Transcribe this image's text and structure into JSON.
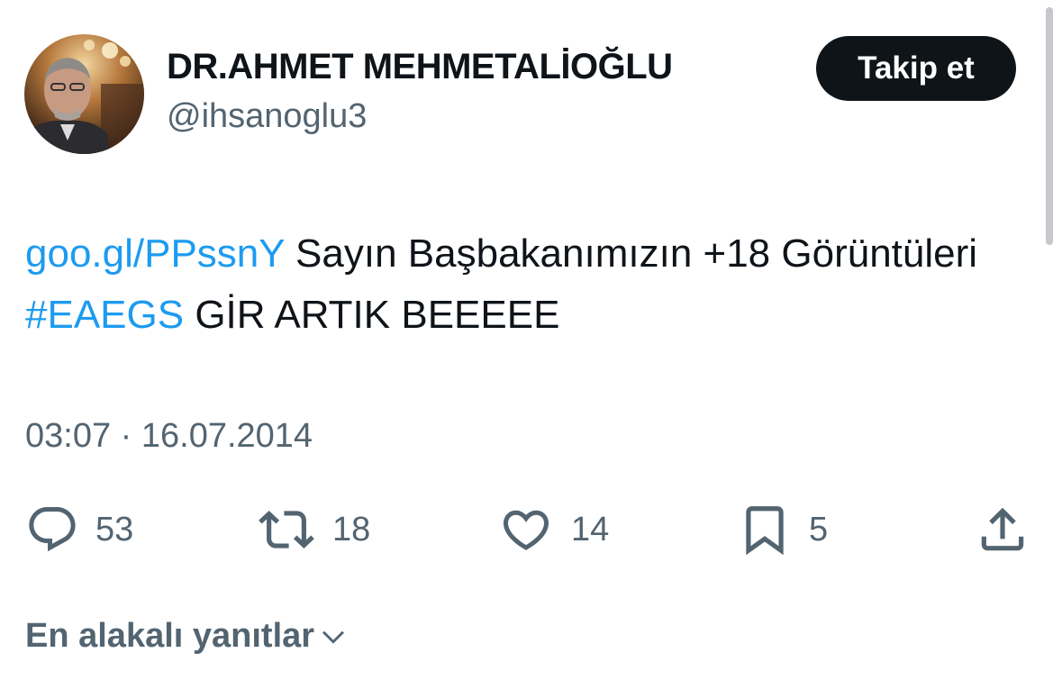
{
  "author": {
    "display_name": "DR.AHMET MEHMETALİOĞLU",
    "handle": "@ihsanoglu3"
  },
  "follow_button": {
    "label": "Takip et"
  },
  "tweet": {
    "link_text": "goo.gl/PPssnY",
    "text_part1": " Sayın Başbakanımızın +18 Görüntüleri ",
    "hashtag": "#EAEGS",
    "text_part2": " GİR ARTIK BEEEEE"
  },
  "timestamp": "03:07 · 16.07.2014",
  "actions": {
    "replies": "53",
    "retweets": "18",
    "likes": "14",
    "bookmarks": "5"
  },
  "replies_sort": {
    "label": "En alakalı yanıtlar"
  },
  "colors": {
    "link": "#1d9bf0",
    "secondary_text": "#536471",
    "primary_text": "#0f1419",
    "button_bg": "#0f1419"
  },
  "icons": {
    "reply": "speech-bubble-icon",
    "retweet": "retweet-arrows-icon",
    "like": "heart-icon",
    "bookmark": "bookmark-icon",
    "share": "share-upload-icon",
    "sort": "chevron-down-icon"
  }
}
